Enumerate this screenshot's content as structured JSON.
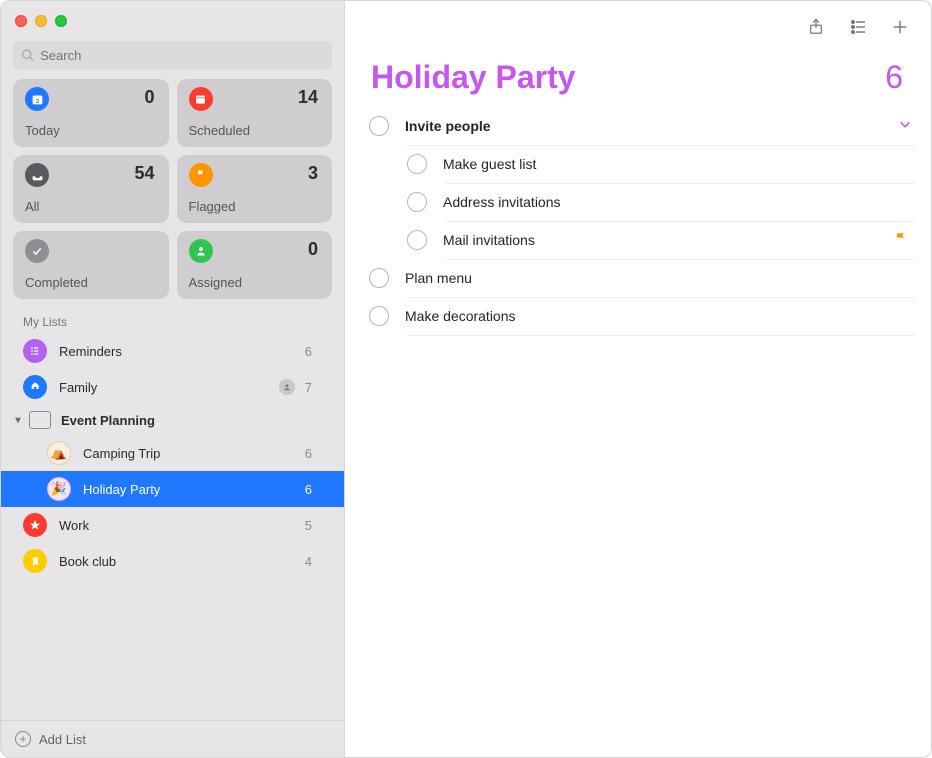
{
  "search": {
    "placeholder": "Search"
  },
  "smart_lists": [
    {
      "id": "today",
      "label": "Today",
      "count": 0,
      "color": "#1f78ff"
    },
    {
      "id": "scheduled",
      "label": "Scheduled",
      "count": 14,
      "color": "#ff3b30"
    },
    {
      "id": "all",
      "label": "All",
      "count": 54,
      "color": "#5a5a5e"
    },
    {
      "id": "flagged",
      "label": "Flagged",
      "count": 3,
      "color": "#ff9500"
    },
    {
      "id": "completed",
      "label": "Completed",
      "count": "",
      "color": "#8e8e93"
    },
    {
      "id": "assigned",
      "label": "Assigned",
      "count": 0,
      "color": "#30c450"
    }
  ],
  "sidebar": {
    "section_title": "My Lists",
    "lists": [
      {
        "id": "reminders",
        "name": "Reminders",
        "count": 6,
        "color": "#b062f2",
        "icon": "list"
      },
      {
        "id": "family",
        "name": "Family",
        "count": 7,
        "color": "#1f78ff",
        "icon": "home",
        "shared": true
      }
    ],
    "group": {
      "name": "Event Planning",
      "expanded": true,
      "children": [
        {
          "id": "camping",
          "name": "Camping Trip",
          "count": 6,
          "emoji": "⛺"
        },
        {
          "id": "holiday",
          "name": "Holiday Party",
          "count": 6,
          "emoji": "🎉",
          "selected": true
        }
      ]
    },
    "lists_after": [
      {
        "id": "work",
        "name": "Work",
        "count": 5,
        "color": "#ff3b30",
        "icon": "star"
      },
      {
        "id": "book",
        "name": "Book club",
        "count": 4,
        "color": "#ffcc00",
        "icon": "bookmark"
      }
    ],
    "add_list_label": "Add List"
  },
  "main": {
    "title": "Holiday Party",
    "count": 6,
    "accent": "#c656ef",
    "reminders": [
      {
        "title": "Invite people",
        "parent": true,
        "expanded": true
      },
      {
        "title": "Make guest list",
        "child": true
      },
      {
        "title": "Address invitations",
        "child": true
      },
      {
        "title": "Mail invitations",
        "child": true,
        "flagged": true
      },
      {
        "title": "Plan menu"
      },
      {
        "title": "Make decorations"
      }
    ]
  }
}
